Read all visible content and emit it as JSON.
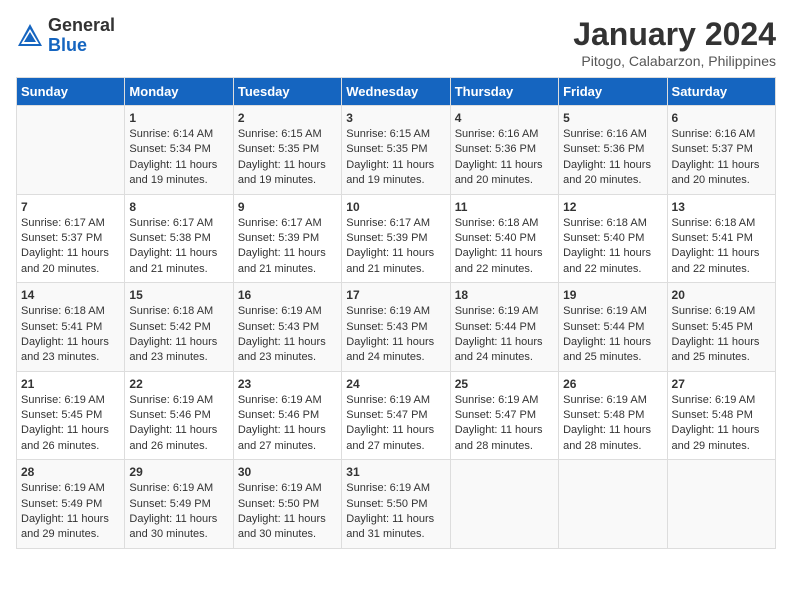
{
  "header": {
    "logo_general": "General",
    "logo_blue": "Blue",
    "month_title": "January 2024",
    "location": "Pitogo, Calabarzon, Philippines"
  },
  "days_of_week": [
    "Sunday",
    "Monday",
    "Tuesday",
    "Wednesday",
    "Thursday",
    "Friday",
    "Saturday"
  ],
  "weeks": [
    [
      {
        "day": "",
        "sunrise": "",
        "sunset": "",
        "daylight": ""
      },
      {
        "day": "1",
        "sunrise": "Sunrise: 6:14 AM",
        "sunset": "Sunset: 5:34 PM",
        "daylight": "Daylight: 11 hours and 19 minutes."
      },
      {
        "day": "2",
        "sunrise": "Sunrise: 6:15 AM",
        "sunset": "Sunset: 5:35 PM",
        "daylight": "Daylight: 11 hours and 19 minutes."
      },
      {
        "day": "3",
        "sunrise": "Sunrise: 6:15 AM",
        "sunset": "Sunset: 5:35 PM",
        "daylight": "Daylight: 11 hours and 19 minutes."
      },
      {
        "day": "4",
        "sunrise": "Sunrise: 6:16 AM",
        "sunset": "Sunset: 5:36 PM",
        "daylight": "Daylight: 11 hours and 20 minutes."
      },
      {
        "day": "5",
        "sunrise": "Sunrise: 6:16 AM",
        "sunset": "Sunset: 5:36 PM",
        "daylight": "Daylight: 11 hours and 20 minutes."
      },
      {
        "day": "6",
        "sunrise": "Sunrise: 6:16 AM",
        "sunset": "Sunset: 5:37 PM",
        "daylight": "Daylight: 11 hours and 20 minutes."
      }
    ],
    [
      {
        "day": "7",
        "sunrise": "Sunrise: 6:17 AM",
        "sunset": "Sunset: 5:37 PM",
        "daylight": "Daylight: 11 hours and 20 minutes."
      },
      {
        "day": "8",
        "sunrise": "Sunrise: 6:17 AM",
        "sunset": "Sunset: 5:38 PM",
        "daylight": "Daylight: 11 hours and 21 minutes."
      },
      {
        "day": "9",
        "sunrise": "Sunrise: 6:17 AM",
        "sunset": "Sunset: 5:39 PM",
        "daylight": "Daylight: 11 hours and 21 minutes."
      },
      {
        "day": "10",
        "sunrise": "Sunrise: 6:17 AM",
        "sunset": "Sunset: 5:39 PM",
        "daylight": "Daylight: 11 hours and 21 minutes."
      },
      {
        "day": "11",
        "sunrise": "Sunrise: 6:18 AM",
        "sunset": "Sunset: 5:40 PM",
        "daylight": "Daylight: 11 hours and 22 minutes."
      },
      {
        "day": "12",
        "sunrise": "Sunrise: 6:18 AM",
        "sunset": "Sunset: 5:40 PM",
        "daylight": "Daylight: 11 hours and 22 minutes."
      },
      {
        "day": "13",
        "sunrise": "Sunrise: 6:18 AM",
        "sunset": "Sunset: 5:41 PM",
        "daylight": "Daylight: 11 hours and 22 minutes."
      }
    ],
    [
      {
        "day": "14",
        "sunrise": "Sunrise: 6:18 AM",
        "sunset": "Sunset: 5:41 PM",
        "daylight": "Daylight: 11 hours and 23 minutes."
      },
      {
        "day": "15",
        "sunrise": "Sunrise: 6:18 AM",
        "sunset": "Sunset: 5:42 PM",
        "daylight": "Daylight: 11 hours and 23 minutes."
      },
      {
        "day": "16",
        "sunrise": "Sunrise: 6:19 AM",
        "sunset": "Sunset: 5:43 PM",
        "daylight": "Daylight: 11 hours and 23 minutes."
      },
      {
        "day": "17",
        "sunrise": "Sunrise: 6:19 AM",
        "sunset": "Sunset: 5:43 PM",
        "daylight": "Daylight: 11 hours and 24 minutes."
      },
      {
        "day": "18",
        "sunrise": "Sunrise: 6:19 AM",
        "sunset": "Sunset: 5:44 PM",
        "daylight": "Daylight: 11 hours and 24 minutes."
      },
      {
        "day": "19",
        "sunrise": "Sunrise: 6:19 AM",
        "sunset": "Sunset: 5:44 PM",
        "daylight": "Daylight: 11 hours and 25 minutes."
      },
      {
        "day": "20",
        "sunrise": "Sunrise: 6:19 AM",
        "sunset": "Sunset: 5:45 PM",
        "daylight": "Daylight: 11 hours and 25 minutes."
      }
    ],
    [
      {
        "day": "21",
        "sunrise": "Sunrise: 6:19 AM",
        "sunset": "Sunset: 5:45 PM",
        "daylight": "Daylight: 11 hours and 26 minutes."
      },
      {
        "day": "22",
        "sunrise": "Sunrise: 6:19 AM",
        "sunset": "Sunset: 5:46 PM",
        "daylight": "Daylight: 11 hours and 26 minutes."
      },
      {
        "day": "23",
        "sunrise": "Sunrise: 6:19 AM",
        "sunset": "Sunset: 5:46 PM",
        "daylight": "Daylight: 11 hours and 27 minutes."
      },
      {
        "day": "24",
        "sunrise": "Sunrise: 6:19 AM",
        "sunset": "Sunset: 5:47 PM",
        "daylight": "Daylight: 11 hours and 27 minutes."
      },
      {
        "day": "25",
        "sunrise": "Sunrise: 6:19 AM",
        "sunset": "Sunset: 5:47 PM",
        "daylight": "Daylight: 11 hours and 28 minutes."
      },
      {
        "day": "26",
        "sunrise": "Sunrise: 6:19 AM",
        "sunset": "Sunset: 5:48 PM",
        "daylight": "Daylight: 11 hours and 28 minutes."
      },
      {
        "day": "27",
        "sunrise": "Sunrise: 6:19 AM",
        "sunset": "Sunset: 5:48 PM",
        "daylight": "Daylight: 11 hours and 29 minutes."
      }
    ],
    [
      {
        "day": "28",
        "sunrise": "Sunrise: 6:19 AM",
        "sunset": "Sunset: 5:49 PM",
        "daylight": "Daylight: 11 hours and 29 minutes."
      },
      {
        "day": "29",
        "sunrise": "Sunrise: 6:19 AM",
        "sunset": "Sunset: 5:49 PM",
        "daylight": "Daylight: 11 hours and 30 minutes."
      },
      {
        "day": "30",
        "sunrise": "Sunrise: 6:19 AM",
        "sunset": "Sunset: 5:50 PM",
        "daylight": "Daylight: 11 hours and 30 minutes."
      },
      {
        "day": "31",
        "sunrise": "Sunrise: 6:19 AM",
        "sunset": "Sunset: 5:50 PM",
        "daylight": "Daylight: 11 hours and 31 minutes."
      },
      {
        "day": "",
        "sunrise": "",
        "sunset": "",
        "daylight": ""
      },
      {
        "day": "",
        "sunrise": "",
        "sunset": "",
        "daylight": ""
      },
      {
        "day": "",
        "sunrise": "",
        "sunset": "",
        "daylight": ""
      }
    ]
  ]
}
